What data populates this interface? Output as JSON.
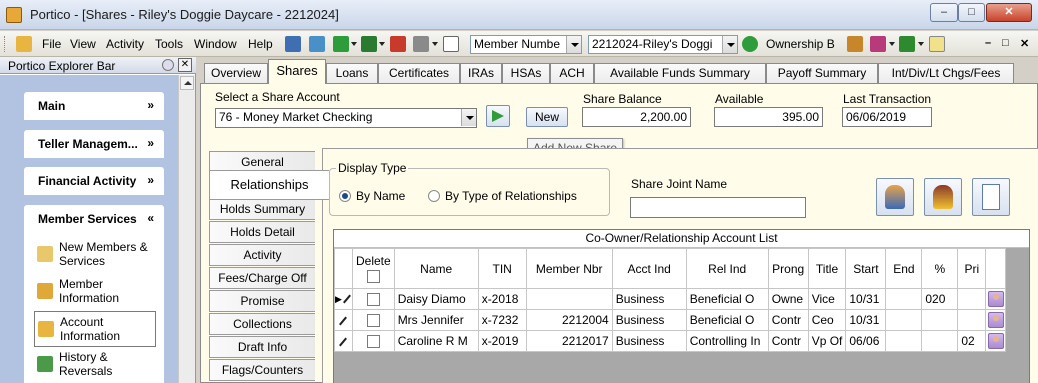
{
  "window": {
    "title": "Portico - [Shares - Riley's Doggie Daycare - 2212024]",
    "controls": {
      "minimize": "–",
      "restore": "□",
      "close": "✕"
    }
  },
  "menu": {
    "items": [
      "File",
      "View",
      "Activity",
      "Tools",
      "Window",
      "Help"
    ],
    "search_type": "Member Numbe",
    "member_select": "2212024-Riley's Doggi",
    "ownership": "Ownership B",
    "mdi_controls": [
      "–",
      "□",
      "✕"
    ]
  },
  "explorer": {
    "title": "Portico Explorer Bar",
    "close": "✕",
    "groups": [
      {
        "label": "Main",
        "chevron": "»",
        "expanded": false
      },
      {
        "label": "Teller Managem...",
        "chevron": "»",
        "expanded": false
      },
      {
        "label": "Financial Activity",
        "chevron": "»",
        "expanded": false
      },
      {
        "label": "Member Services",
        "chevron": "«",
        "expanded": true
      }
    ],
    "items": [
      {
        "label": "New Members & Services",
        "selected": false
      },
      {
        "label": "Member Information",
        "selected": false
      },
      {
        "label": "Account Information",
        "selected": true
      },
      {
        "label": "History & Reversals",
        "selected": false
      }
    ]
  },
  "tabs": [
    "Overview",
    "Shares",
    "Loans",
    "Certificates",
    "IRAs",
    "HSAs",
    "ACH",
    "Available Funds Summary",
    "Payoff Summary",
    "Int/Div/Lt Chgs/Fees"
  ],
  "active_tab": "Shares",
  "share": {
    "select_label": "Select a Share Account",
    "selected": "76 - Money Market Checking",
    "new_button": "New",
    "tooltip": "Add New Share",
    "balance_label": "Share Balance",
    "balance": "2,200.00",
    "available_label": "Available",
    "available": "395.00",
    "last_tx_label": "Last Transaction",
    "last_tx": "06/06/2019"
  },
  "side_tabs": [
    "General",
    "Relationships",
    "Holds Summary",
    "Holds Detail",
    "Activity",
    "Fees/Charge Off",
    "Promise",
    "Collections",
    "Draft Info",
    "Flags/Counters"
  ],
  "active_side_tab": "Relationships",
  "display_type": {
    "caption": "Display Type",
    "options": [
      "By Name",
      "By Type of Relationships"
    ],
    "selected": "By Name"
  },
  "joint": {
    "label": "Share Joint  Name",
    "value": ""
  },
  "grid": {
    "caption": "Co-Owner/Relationship Account List",
    "columns": [
      "",
      "Delete",
      "Name",
      "TIN",
      "Member Nbr",
      "Acct Ind",
      "Rel Ind",
      "Prong",
      "Title",
      "Start",
      "End",
      "%",
      "Pri",
      ""
    ],
    "rows": [
      {
        "current": true,
        "name": "Daisy Diamo",
        "tin": "x-2018",
        "member_nbr": "",
        "acct_ind": "Business",
        "rel_ind": "Beneficial O",
        "prong": "Owne",
        "title": "Vice",
        "start": "10/31",
        "end": "",
        "pct": "020",
        "pri": ""
      },
      {
        "current": false,
        "name": "Mrs Jennifer",
        "tin": "x-7232",
        "member_nbr": "2212004",
        "acct_ind": "Business",
        "rel_ind": "Beneficial O",
        "prong": "Contr",
        "title": "Ceo",
        "start": "10/31",
        "end": "",
        "pct": "",
        "pri": ""
      },
      {
        "current": false,
        "name": "Caroline R M",
        "tin": "x-2019",
        "member_nbr": "2212017",
        "acct_ind": "Business",
        "rel_ind": "Controlling In",
        "prong": "Contr",
        "title": "Vp Of",
        "start": "06/06",
        "end": "",
        "pct": "",
        "pri": "02"
      }
    ]
  },
  "colors": {
    "panel_bg": "#fffcea",
    "explorer_bg": "#b1c3e0",
    "chrome": "#d4d0c8"
  }
}
